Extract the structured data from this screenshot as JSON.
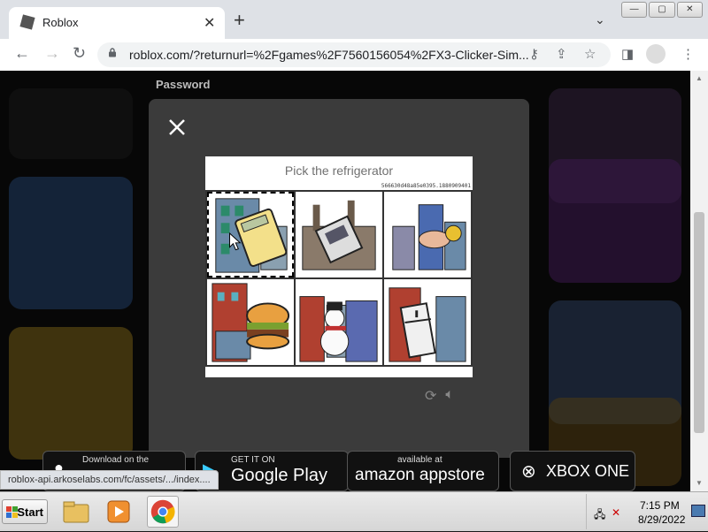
{
  "browser": {
    "tab_title": "Roblox",
    "tab_close": "✕",
    "new_tab": "+",
    "url": "roblox.com/?returnurl=%2Fgames%2F7560156054%2FX3-Clicker-Sim...",
    "window_buttons": [
      "—",
      "▢",
      "✕"
    ]
  },
  "page": {
    "password_label": "Password"
  },
  "captcha": {
    "prompt": "Pick the refrigerator",
    "token": "566630d48a85e0395.1880909401",
    "tiles": [
      {
        "icon": "calculator-building-icon",
        "selected": true
      },
      {
        "icon": "machine-factory-icon",
        "selected": false
      },
      {
        "icon": "money-hand-city-icon",
        "selected": false
      },
      {
        "icon": "burger-building-icon",
        "selected": false
      },
      {
        "icon": "snowman-building-icon",
        "selected": false
      },
      {
        "icon": "refrigerator-building-icon",
        "selected": false
      }
    ],
    "actions": [
      "refresh-icon",
      "audio-icon"
    ]
  },
  "badges": {
    "apple_small": "Download on the",
    "google_small": "GET IT ON",
    "google_big": "Google Play",
    "amazon_small": "available at",
    "amazon_big": "amazon appstore",
    "xbox_big": "XBOX ONE"
  },
  "status_bar": "roblox-api.arkoselabs.com/fc/assets/.../index....",
  "taskbar": {
    "start_label": "Start",
    "time": "7:15 PM",
    "date": "8/29/2022"
  },
  "colors": {
    "modal_bg": "#3b3b3b",
    "prompt_text": "#707070"
  }
}
